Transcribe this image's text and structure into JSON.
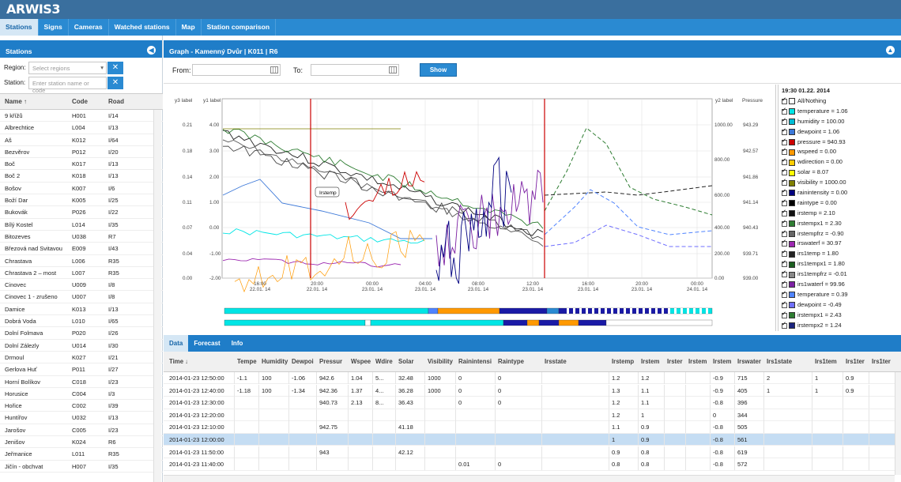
{
  "app": {
    "logo": "ARWIS3"
  },
  "nav": [
    "Stations",
    "Signs",
    "Cameras",
    "Watched stations",
    "Map",
    "Station comparison"
  ],
  "sidebar": {
    "title": "Stations",
    "region_label": "Region:",
    "region_placeholder": "Select regions",
    "station_label": "Station:",
    "station_placeholder": "Enter station name or code",
    "col_name": "Name ↑",
    "col_code": "Code",
    "col_road": "Road",
    "rows": [
      [
        "9 křížů",
        "H001",
        "I/14"
      ],
      [
        "Albrechtice",
        "L004",
        "I/13"
      ],
      [
        "Aš",
        "K012",
        "I/64"
      ],
      [
        "Bezvěrov",
        "P012",
        "I/20"
      ],
      [
        "Boč",
        "K017",
        "I/13"
      ],
      [
        "Boč 2",
        "K018",
        "I/13"
      ],
      [
        "Bošov",
        "K007",
        "I/6"
      ],
      [
        "Boží Dar",
        "K005",
        "I/25"
      ],
      [
        "Bukovák",
        "P026",
        "I/22"
      ],
      [
        "Bílý Kostel",
        "L014",
        "I/35"
      ],
      [
        "Bitozeves",
        "U038",
        "R7"
      ],
      [
        "Březová nad Svitavou",
        "E009",
        "I/43"
      ],
      [
        "Chrastava",
        "L006",
        "R35"
      ],
      [
        "Chrastava 2 – most",
        "L007",
        "R35"
      ],
      [
        "Cinovec",
        "U009",
        "I/8"
      ],
      [
        "Cinovec 1 - zrušeno",
        "U007",
        "I/8"
      ],
      [
        "Damice",
        "K013",
        "I/13"
      ],
      [
        "Dobrá Voda",
        "L010",
        "I/65"
      ],
      [
        "Dolní Folmava",
        "P020",
        "I/26"
      ],
      [
        "Dolní Zálezly",
        "U014",
        "I/30"
      ],
      [
        "Drmoul",
        "K027",
        "I/21"
      ],
      [
        "Gerlova Huť",
        "P011",
        "I/27"
      ],
      [
        "Horní Bolíkov",
        "C018",
        "I/23"
      ],
      [
        "Horusice",
        "C004",
        "I/3"
      ],
      [
        "Hořice",
        "C002",
        "I/39"
      ],
      [
        "Huntířov",
        "U032",
        "I/13"
      ],
      [
        "Jarošov",
        "C005",
        "I/23"
      ],
      [
        "Jenišov",
        "K024",
        "R6"
      ],
      [
        "Jeřmanice",
        "L011",
        "R35"
      ],
      [
        "Jičín - obchvat",
        "H007",
        "I/35"
      ]
    ]
  },
  "graph": {
    "title": "Graph - Kamenný Dvůr | K011 | R6",
    "from_label": "From:",
    "to_label": "To:",
    "show": "Show",
    "y3_label": "y3 label",
    "y1_label": "y1 label",
    "y2_label": "y2 label",
    "pressure_label": "Pressure",
    "y3_ticks": [
      "0.21",
      "0.18",
      "0.14",
      "0.11",
      "0.07",
      "0.04",
      "0.00"
    ],
    "y1_ticks": [
      "4.00",
      "3.00",
      "2.00",
      "1.00",
      "0.00",
      "-1.00",
      "-2.00"
    ],
    "y2_ticks": [
      "1000.00",
      "800.00",
      "600.00",
      "400.00",
      "200.00",
      "0.00"
    ],
    "pr_ticks": [
      "943.29",
      "942.57",
      "941.86",
      "941.14",
      "940.43",
      "939.71",
      "939.00"
    ],
    "x_ticks": [
      [
        "16:00",
        "22.01. 14"
      ],
      [
        "20:00",
        "22.01. 14"
      ],
      [
        "00:00",
        "23.01. 14"
      ],
      [
        "04:00",
        "23.01. 14"
      ],
      [
        "08:00",
        "23.01. 14"
      ],
      [
        "12:00",
        "23.01. 14"
      ],
      [
        "16:00",
        "23.01. 14"
      ],
      [
        "20:00",
        "23.01. 14"
      ],
      [
        "00:00",
        "24.01. 14"
      ]
    ],
    "tooltip": "Irstemp"
  },
  "legend": {
    "title": "19:30 01.22. 2014",
    "items": [
      [
        "All/Nothing",
        "#ffffff"
      ],
      [
        "temperature = 1.06",
        "#00e5e5"
      ],
      [
        "humidity = 100.00",
        "#00bcd4"
      ],
      [
        "dewpoint = 1.06",
        "#3c78d8"
      ],
      [
        "pressure = 940.93",
        "#cc0000"
      ],
      [
        "wspeed = 0.00",
        "#ff9900"
      ],
      [
        "wdirection = 0.00",
        "#ffcc00"
      ],
      [
        "solar = 8.07",
        "#ffff00"
      ],
      [
        "visibility = 1000.00",
        "#7f7f00"
      ],
      [
        "rainintensity = 0.00",
        "#000080"
      ],
      [
        "raintype = 0.00",
        "#000000"
      ],
      [
        "irstemp = 2.10",
        "#111111"
      ],
      [
        "irstempx1 = 2.30",
        "#2e7d32"
      ],
      [
        "irstempfrz = -0.90",
        "#666666"
      ],
      [
        "irswaterf = 30.97",
        "#9c27b0"
      ],
      [
        "irs1temp = 1.80",
        "#222222"
      ],
      [
        "irs1tempx1 = 1.80",
        "#1b5e20"
      ],
      [
        "irs1tempfrz = -0.01",
        "#888888"
      ],
      [
        "irs1waterf = 99.96",
        "#7b1fa2"
      ],
      [
        "temperature = 0.39",
        "#4f83ff"
      ],
      [
        "dewpoint = -0.49",
        "#6f6fff"
      ],
      [
        "irstempx1 = 2.43",
        "#2e7d32"
      ],
      [
        "irstempx2 = 1.24",
        "#1a237e"
      ]
    ]
  },
  "data": {
    "tabs": [
      "Data",
      "Forecast",
      "Info"
    ],
    "columns": [
      "Time ↓",
      "Tempe",
      "Humidity",
      "Dewpoi",
      "Pressur",
      "Wspee",
      "Wdire",
      "Solar",
      "Visibility",
      "Rainintensi",
      "Raintype",
      "Irsstate",
      "Irstemp",
      "Irstem",
      "Irster",
      "Irstem",
      "Irstem",
      "Irswater",
      "Irs1state",
      "Irs1tem",
      "Irs1ter",
      "Irs1ter"
    ],
    "rows": [
      [
        "2014-01-23 12:50:00",
        "-1.1",
        "100",
        "-1.06",
        "942.6",
        "1.04",
        "5...",
        "32.48",
        "1000",
        "0",
        "0",
        "",
        "1.2",
        "1.2",
        "",
        "",
        "-0.9",
        "715",
        "2",
        "1",
        "0.9",
        ""
      ],
      [
        "2014-01-23 12:40:00",
        "-1.18",
        "100",
        "-1.34",
        "942.36",
        "1.37",
        "4...",
        "36.28",
        "1000",
        "0",
        "0",
        "",
        "1.3",
        "1.1",
        "",
        "",
        "-0.9",
        "405",
        "1",
        "1",
        "0.9",
        ""
      ],
      [
        "2014-01-23 12:30:00",
        "",
        "",
        "",
        "940.73",
        "2.13",
        "8...",
        "36.43",
        "",
        "0",
        "0",
        "",
        "1.2",
        "1.1",
        "",
        "",
        "-0.8",
        "396",
        "",
        "",
        "",
        ""
      ],
      [
        "2014-01-23 12:20:00",
        "",
        "",
        "",
        "",
        "",
        "",
        "",
        "",
        "",
        "",
        "",
        "1.2",
        "1",
        "",
        "",
        "0",
        "344",
        "",
        "",
        "",
        ""
      ],
      [
        "2014-01-23 12:10:00",
        "",
        "",
        "",
        "942.75",
        "",
        "",
        "41.18",
        "",
        "",
        "",
        "",
        "1.1",
        "0.9",
        "",
        "",
        "-0.8",
        "505",
        "",
        "",
        "",
        ""
      ],
      [
        "2014-01-23 12:00:00",
        "",
        "",
        "",
        "",
        "",
        "",
        "",
        "",
        "",
        "",
        "",
        "1",
        "0.9",
        "",
        "",
        "-0.8",
        "561",
        "",
        "",
        "",
        ""
      ],
      [
        "2014-01-23 11:50:00",
        "",
        "",
        "",
        "943",
        "",
        "",
        "42.12",
        "",
        "",
        "",
        "",
        "0.9",
        "0.8",
        "",
        "",
        "-0.8",
        "619",
        "",
        "",
        "",
        ""
      ],
      [
        "2014-01-23 11:40:00",
        "",
        "",
        "",
        "",
        "",
        "",
        "",
        "",
        "0.01",
        "0",
        "",
        "0.8",
        "0.8",
        "",
        "",
        "-0.8",
        "572",
        "",
        "",
        "",
        ""
      ]
    ]
  }
}
